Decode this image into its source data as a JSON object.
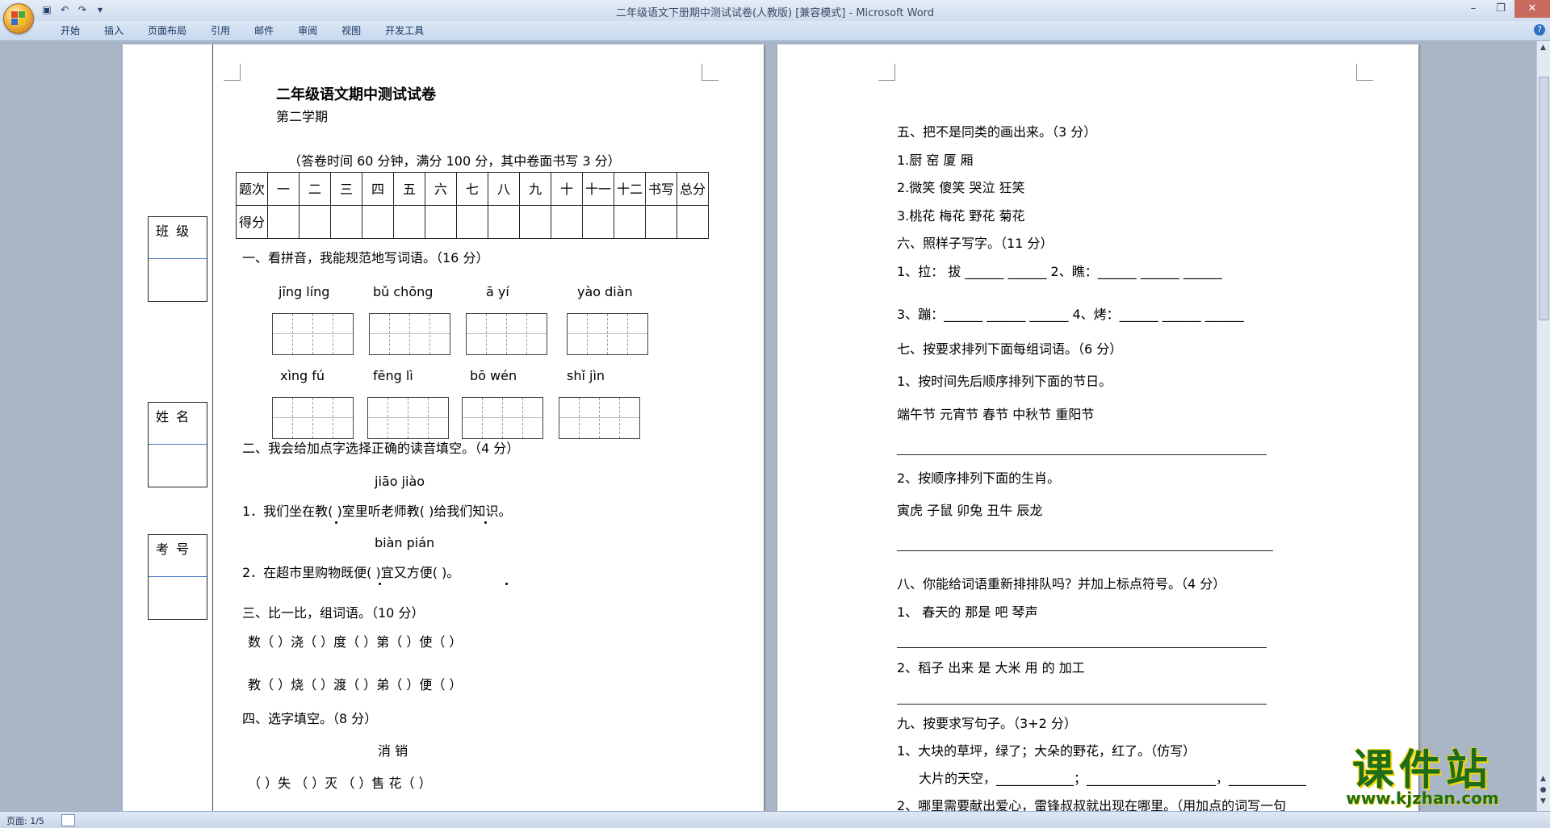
{
  "window": {
    "title": "二年级语文下册期中测试试卷(人教版) [兼容模式] - Microsoft Word"
  },
  "ribbon": {
    "tabs": [
      "开始",
      "插入",
      "页面布局",
      "引用",
      "邮件",
      "审阅",
      "视图",
      "开发工具"
    ]
  },
  "status": {
    "page": "页面: 1/5"
  },
  "page1": {
    "title": "二年级语文期中测试试卷",
    "semester": "第二学期",
    "instructions": "（答卷时间 60 分钟，满分 100 分，其中卷面书写 3 分）",
    "side_labels": [
      "班 级",
      "姓 名",
      "考 号"
    ],
    "table_header": [
      "题次",
      "一",
      "二",
      "三",
      "四",
      "五",
      "六",
      "七",
      "八",
      "九",
      "十",
      "十一",
      "十二",
      "书写",
      "总分"
    ],
    "table_row2": [
      "得分",
      "",
      "",
      "",
      "",
      "",
      "",
      "",
      "",
      "",
      "",
      "",
      "",
      "",
      ""
    ],
    "q1": {
      "heading": "一、看拼音，我能规范地写词语。（16 分）",
      "pinyin_row1": [
        "jīng  líng",
        "bǔ  chōng",
        "ā  yí",
        "yào  diàn"
      ],
      "pinyin_row2": [
        "xìng  fú",
        "fēng  lì",
        "bō  wén",
        "shǐ  jìn"
      ]
    },
    "q2": {
      "heading": "二、我会给加点字选择正确的读音填空。（4 分）",
      "pinyin1": "jiāo    jiào",
      "sentence1": "1．我们坐在教(      )室里听老师教(      )给我们知识。",
      "pinyin2": "biàn    pián",
      "sentence2": "2．在超市里购物既便(       )宜又方便(       )。"
    },
    "q3": {
      "heading": "三、比一比，组词语。（10 分）",
      "row1": "数（      ）浇（      ）度（      ）第（      ）使（      ）",
      "row2": "教（      ）烧（      ）渡（      ）弟（      ）便（      ）"
    },
    "q4": {
      "heading": "四、选字填空。（8 分）",
      "chars": "消         销",
      "row": "（      ）失      （      ）灭      （      ）售      花（      ）"
    }
  },
  "page2": {
    "q5": {
      "heading": "五、把不是同类的画出来。（3 分）",
      "rows": [
        "1.厨      窑      厦      厢",
        "2.微笑    傻笑    哭泣    狂笑",
        "3.桃花    梅花    野花    菊花"
      ]
    },
    "q6": {
      "heading": "六、照样子写字。（11 分）",
      "row1": "1、拉：  拔    ______  ______  2、瞧：______  ______  ______",
      "row2": "3、蹦：______  ______  ______  4、烤：______  ______  ______"
    },
    "q7": {
      "heading": "七、按要求排列下面每组词语。（6 分）",
      "sub1": "1、按时间先后顺序排列下面的节日。",
      "festivals": "端午节      元宵节      春节        中秋节      重阳节",
      "sub2": "2、按顺序排列下面的生肖。",
      "zodiac": "寅虎          子鼠          卯兔          丑牛          辰龙"
    },
    "q8": {
      "heading": "八、你能给词语重新排排队吗？并加上标点符号。（4 分）",
      "row1": "1、   春天的   那是   吧   琴声",
      "row2": "2、稻子    出来    是    大米    用     的    加工"
    },
    "q9": {
      "heading": "九、按要求写句子。（3+2 分）",
      "row1": "1、大块的草坪，绿了；大朵的野花，红了。（仿写）",
      "row2": "大片的天空，____________；____________________，____________",
      "row3": "2、哪里需要献出爱心，雷锋叔叔就出现在哪里。（用加点的词写一句"
    }
  },
  "watermark": {
    "big": "课件站",
    "small": "www.kjzhan.com"
  },
  "colors": {
    "ribbon": "#c8d8ee",
    "workspace": "#a9b6c6",
    "watermark": "#1e6d1a"
  }
}
